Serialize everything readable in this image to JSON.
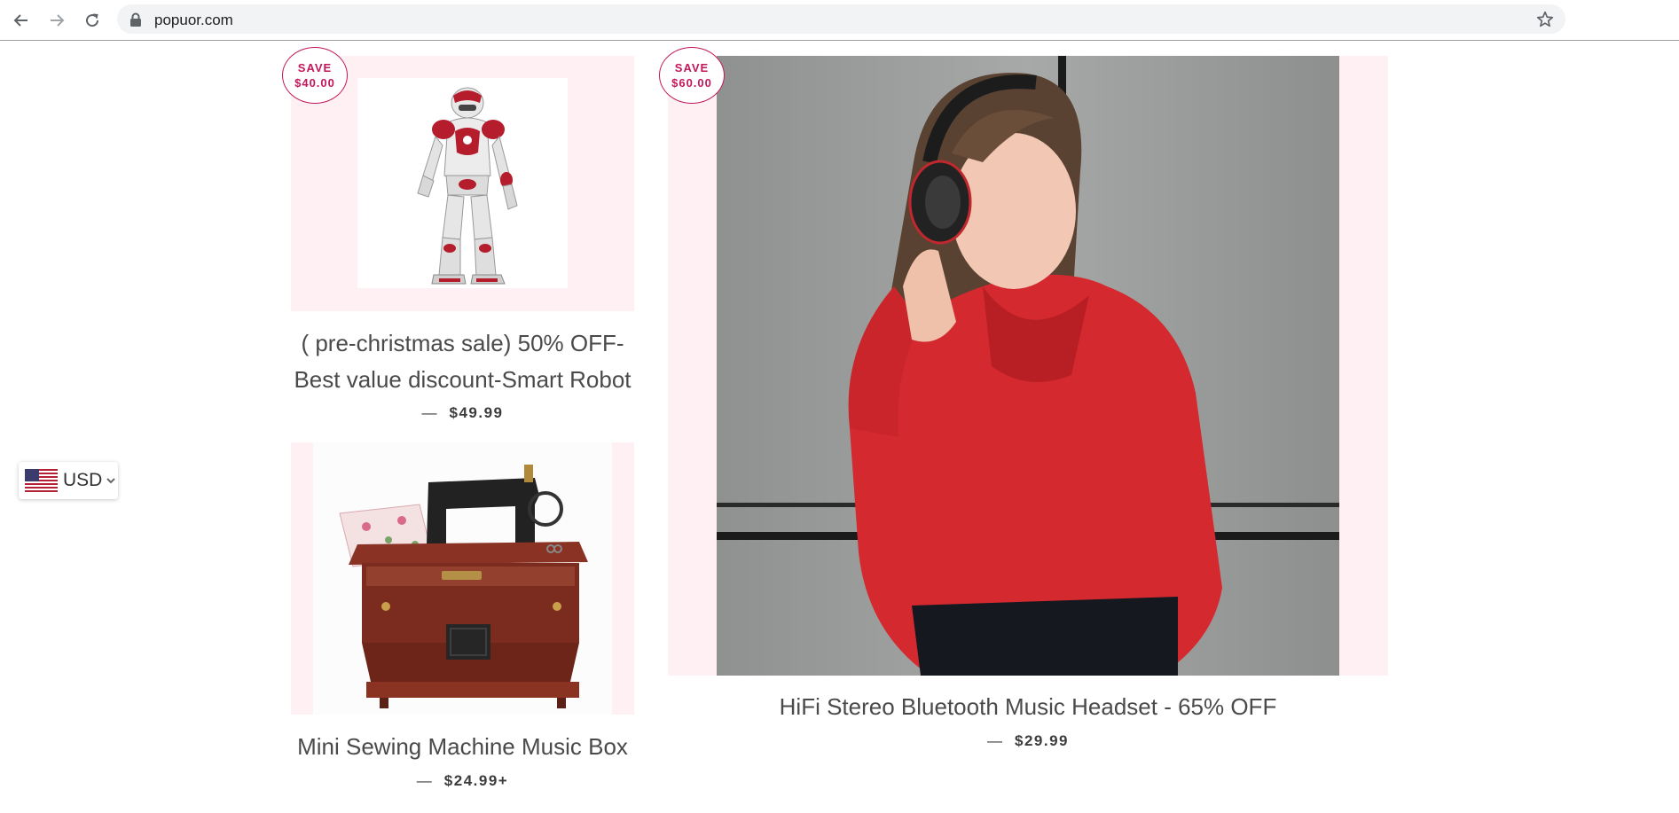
{
  "browser": {
    "url": "popuor.com"
  },
  "products": [
    {
      "save_line1": "SAVE",
      "save_line2": "$40.00",
      "title_line1": "( pre-christmas sale) 50% OFF-",
      "title_line2": "Best value discount-Smart Robot",
      "price_dash": "—",
      "price": "$49.99"
    },
    {
      "save_line1": "SAVE",
      "save_line2": "$60.00",
      "title": "HiFi Stereo Bluetooth Music Headset - 65% OFF",
      "price_dash": "—",
      "price": "$29.99"
    },
    {
      "title": "Mini Sewing Machine Music Box",
      "price_dash": "—",
      "price": "$24.99+"
    }
  ],
  "currency": {
    "code": "USD"
  },
  "icons": {
    "back": "arrow-left-icon",
    "forward": "arrow-right-icon",
    "reload": "reload-icon",
    "lock": "lock-icon",
    "bookmark": "star-icon",
    "flag": "us-flag-icon",
    "chevron": "chevron-down-icon"
  },
  "colors": {
    "accent": "#c2185b",
    "image_bg": "#fff0f3",
    "hoodie": "#d42a2f"
  }
}
